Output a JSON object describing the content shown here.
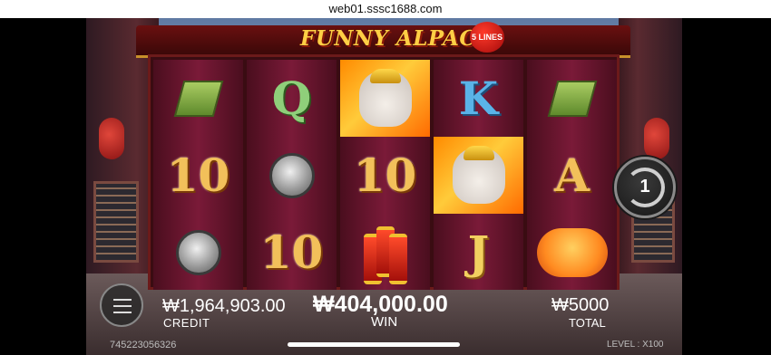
{
  "browser": {
    "url": "web01.sssc1688.com"
  },
  "game": {
    "title": "FUNNY ALPACA",
    "lines_badge": "5 LINES"
  },
  "reels": [
    [
      "mallet",
      "10",
      "gong"
    ],
    [
      "Q",
      "gong",
      "10"
    ],
    [
      "alpaca",
      "10",
      "firecracker"
    ],
    [
      "K",
      "alpaca",
      "J"
    ],
    [
      "mallet",
      "A",
      "pig"
    ]
  ],
  "labels": {
    "q": "Q",
    "k": "K",
    "j": "J",
    "a": "A",
    "ten": "10"
  },
  "controls": {
    "spin_count": "1"
  },
  "hud": {
    "credit_value": "₩1,964,903.00",
    "credit_label": "CREDIT",
    "win_value": "₩404,000.00",
    "win_label": "WIN",
    "total_value": "₩5000",
    "total_label": "TOTAL",
    "game_id": "745223056326",
    "level": "LEVEL : X100"
  },
  "colors": {
    "accent_gold": "#f2c05a",
    "reel_bg": "#7a1a38",
    "alpaca_bg": "#ff8a00"
  }
}
